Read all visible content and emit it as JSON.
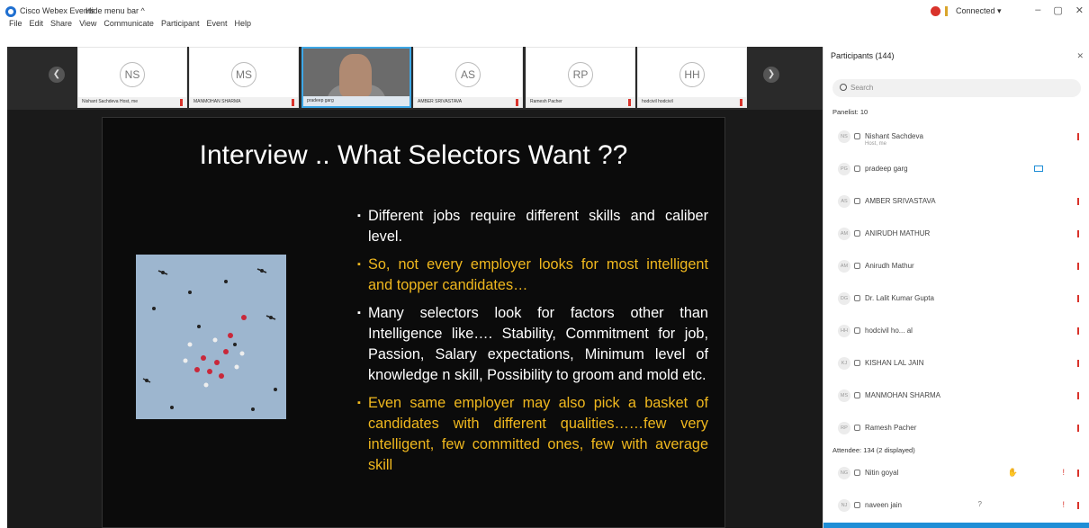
{
  "app": {
    "title": "Cisco Webex Events",
    "hide_menu": "Hide menu bar ^",
    "menu": [
      "File",
      "Edit",
      "Share",
      "View",
      "Communicate",
      "Participant",
      "Event",
      "Help"
    ],
    "status": "Connected ▾",
    "window_buttons": [
      "–",
      "▢",
      "✕"
    ]
  },
  "strip": {
    "tiles": [
      {
        "initials": "NS",
        "caption": "Nishant Sachdeva Host, me"
      },
      {
        "initials": "MS",
        "caption": "MANMOHAN SHARMA"
      },
      {
        "initials": "",
        "caption": "pradeep garg"
      },
      {
        "initials": "AS",
        "caption": "AMBER SRIVASTAVA"
      },
      {
        "initials": "RP",
        "caption": "Ramesh Pacher"
      },
      {
        "initials": "HH",
        "caption": "hodcivil hodcivil"
      }
    ]
  },
  "slide": {
    "title": "Interview .. What Selectors Want ??",
    "bullets": [
      {
        "text": "Different jobs require different skills and caliber level.",
        "color": "white"
      },
      {
        "text": "So, not every employer looks for most intelligent and topper candidates…",
        "color": "yellow"
      },
      {
        "text": "Many selectors look for factors other than Intelligence like…. Stability, Commitment for job, Passion, Salary expectations, Minimum level of knowledge n skill, Possibility to groom and mold etc.",
        "color": "white"
      },
      {
        "text": "Even same employer may also pick a basket of candidates with different qualities……few very intelligent, few committed ones, few with average skill",
        "color": "yellow"
      }
    ]
  },
  "panel": {
    "title": "Participants (144)",
    "search_placeholder": "Search",
    "panelist_header": "Panelist: 10",
    "attendee_header": "Attendee: 134 (2 displayed)",
    "panelists": [
      {
        "initials": "NS",
        "name": "Nishant Sachdeva",
        "sub": "Host, me"
      },
      {
        "initials": "PG",
        "name": "pradeep garg",
        "sub": "",
        "video": true
      },
      {
        "initials": "AS",
        "name": "AMBER SRIVASTAVA",
        "sub": ""
      },
      {
        "initials": "AM",
        "name": "ANIRUDH MATHUR",
        "sub": ""
      },
      {
        "initials": "AM",
        "name": "Anirudh Mathur",
        "sub": ""
      },
      {
        "initials": "DG",
        "name": "Dr. Lalit Kumar Gupta",
        "sub": ""
      },
      {
        "initials": "HH",
        "name": "hodcivil ho...      al",
        "sub": ""
      },
      {
        "initials": "KJ",
        "name": "KISHAN LAL JAIN",
        "sub": ""
      },
      {
        "initials": "MS",
        "name": "MANMOHAN SHARMA",
        "sub": ""
      },
      {
        "initials": "RP",
        "name": "Ramesh Pacher",
        "sub": ""
      }
    ],
    "attendees": [
      {
        "initials": "NG",
        "name": "Nitin goyal"
      },
      {
        "initials": "NJ",
        "name": "naveen jain"
      }
    ]
  }
}
